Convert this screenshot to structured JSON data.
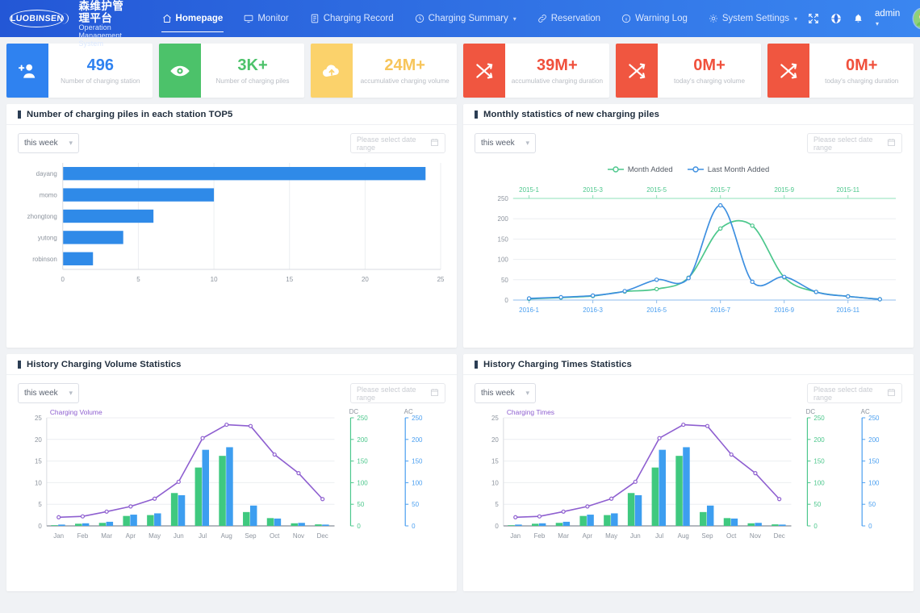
{
  "nav": {
    "logo_mark_text": "LUOBINSEN",
    "title_cn": "大连罗宾森维护管理平台",
    "title_en": "Operation Management System",
    "items": [
      {
        "label": "Homepage",
        "icon": "home-icon",
        "active": true,
        "has_caret": false
      },
      {
        "label": "Monitor",
        "icon": "monitor-icon",
        "active": false,
        "has_caret": false
      },
      {
        "label": "Charging Record",
        "icon": "document-icon",
        "active": false,
        "has_caret": false
      },
      {
        "label": "Charging Summary",
        "icon": "clock-icon",
        "active": false,
        "has_caret": true
      },
      {
        "label": "Reservation",
        "icon": "link-icon",
        "active": false,
        "has_caret": false
      },
      {
        "label": "Warning Log",
        "icon": "info-icon",
        "active": false,
        "has_caret": false
      },
      {
        "label": "System Settings",
        "icon": "gear-icon",
        "active": false,
        "has_caret": true
      }
    ],
    "right": {
      "fullscreen_icon": "fullscreen-icon",
      "language_icon": "globe-icon",
      "notification_icon": "bell-icon",
      "user_label": "admin",
      "avatar_icon": "user-avatar"
    }
  },
  "kpis": [
    {
      "value": "496",
      "label": "Number of charging station",
      "color": "#2f82f0",
      "bg": "#2f82f0",
      "icon": "add-user-icon"
    },
    {
      "value": "3K+",
      "label": "Number of charging piles",
      "color": "#4cc26a",
      "bg": "#4cc26a",
      "icon": "eye-icon"
    },
    {
      "value": "24M+",
      "label": "accumulative charging volume",
      "color": "#f7c55a",
      "bg": "#fbd26b",
      "icon": "cloud-upload-icon"
    },
    {
      "value": "39M+",
      "label": "accumulative charging duration",
      "color": "#f0503c",
      "bg": "#f05640",
      "icon": "shuffle-icon"
    },
    {
      "value": "0M+",
      "label": "today's charging volume",
      "color": "#f0503c",
      "bg": "#f05640",
      "icon": "shuffle-icon"
    },
    {
      "value": "0M+",
      "label": "today's charging duration",
      "color": "#f0503c",
      "bg": "#f05640",
      "icon": "shuffle-icon"
    }
  ],
  "controls": {
    "select_value": "this week",
    "daterange_placeholder": "Please select date range",
    "calendar_icon": "calendar-icon",
    "chevron_icon": "chevron-down-icon"
  },
  "panels": {
    "top_left": {
      "title": "Number of charging piles in each station TOP5"
    },
    "top_right": {
      "title": "Monthly statistics of new charging piles"
    },
    "bottom_left": {
      "title": "History Charging Volume Statistics"
    },
    "bottom_right": {
      "title": "History Charging Times Statistics"
    }
  },
  "chart_data": [
    {
      "id": "station-top5",
      "type": "bar",
      "orientation": "horizontal",
      "title": "Number of charging piles in each station TOP5",
      "categories": [
        "dayang",
        "momo",
        "zhongtong",
        "yutong",
        "robinson"
      ],
      "values": [
        24,
        10,
        6,
        4,
        2
      ],
      "xlabel": "",
      "ylabel": "",
      "xlim": [
        0,
        25
      ],
      "xticks": [
        0,
        5,
        10,
        15,
        20,
        25
      ],
      "bar_color": "#2f8ae8",
      "grid": true,
      "legend": "none"
    },
    {
      "id": "monthly-new-piles",
      "type": "line",
      "title": "Monthly statistics of new charging piles",
      "legend": [
        "Month Added",
        "Last Month Added"
      ],
      "legend_position": "top-center",
      "x_top_ticks": [
        "2015-1",
        "2015-3",
        "2015-5",
        "2015-7",
        "2015-9",
        "2015-11"
      ],
      "x_bottom_ticks": [
        "2016-1",
        "2016-3",
        "2016-5",
        "2016-7",
        "2016-9",
        "2016-11"
      ],
      "ylim": [
        0,
        250
      ],
      "yticks": [
        0,
        50,
        100,
        150,
        200,
        250
      ],
      "series": [
        {
          "name": "Month Added",
          "color": "#4cc78c",
          "axis": "top",
          "x": [
            "2015-1",
            "2015-2",
            "2015-3",
            "2015-4",
            "2015-5",
            "2015-6",
            "2015-7",
            "2015-8",
            "2015-9",
            "2015-10",
            "2015-11",
            "2015-12"
          ],
          "values": [
            3,
            6,
            10,
            21,
            27,
            55,
            176,
            183,
            56,
            20,
            9,
            2
          ]
        },
        {
          "name": "Last Month Added",
          "color": "#3d8fe0",
          "axis": "bottom",
          "x": [
            "2016-1",
            "2016-2",
            "2016-3",
            "2016-4",
            "2016-5",
            "2016-6",
            "2016-7",
            "2016-8",
            "2016-9",
            "2016-10",
            "2016-11",
            "2016-12"
          ],
          "values": [
            4,
            7,
            11,
            22,
            50,
            54,
            233,
            45,
            57,
            20,
            9,
            2
          ]
        }
      ],
      "grid": true
    },
    {
      "id": "history-charging-volume",
      "type": "bar",
      "title": "History Charging Volume Statistics",
      "left_axis_label": "Charging Volume",
      "left_axis_color": "#8e5fd0",
      "categories": [
        "Jan",
        "Feb",
        "Mar",
        "Apr",
        "May",
        "Jun",
        "Jul",
        "Aug",
        "Sep",
        "Oct",
        "Nov",
        "Dec"
      ],
      "left_ylim": [
        0,
        25
      ],
      "left_yticks": [
        0,
        5,
        10,
        15,
        20,
        25
      ],
      "right_axes": [
        {
          "name": "DC",
          "color": "#4cc78c",
          "ylim": [
            0,
            250
          ],
          "yticks": [
            0,
            50,
            100,
            150,
            200,
            250
          ]
        },
        {
          "name": "AC",
          "color": "#4a9ff0",
          "ylim": [
            0,
            250
          ],
          "yticks": [
            0,
            50,
            100,
            150,
            200,
            250
          ]
        }
      ],
      "series": [
        {
          "name": "DC",
          "type": "bar",
          "color": "#3fc97f",
          "values": [
            0.15,
            0.5,
            0.7,
            2.3,
            2.5,
            7.6,
            13.5,
            16.2,
            3.2,
            1.8,
            0.6,
            0.35
          ]
        },
        {
          "name": "AC",
          "type": "bar",
          "color": "#3d9ef0",
          "values": [
            0.3,
            0.6,
            0.95,
            2.6,
            2.9,
            7.1,
            17.6,
            18.2,
            4.7,
            1.7,
            0.7,
            0.3
          ]
        },
        {
          "name": "Charging Volume",
          "type": "line",
          "color": "#8e5fd0",
          "values": [
            2.0,
            2.2,
            3.3,
            4.5,
            6.3,
            10.2,
            20.3,
            23.4,
            23.1,
            16.5,
            12.2,
            6.2
          ]
        }
      ],
      "grid": true
    },
    {
      "id": "history-charging-times",
      "type": "bar",
      "title": "History Charging Times Statistics",
      "left_axis_label": "Charging Times",
      "left_axis_color": "#8e5fd0",
      "categories": [
        "Jan",
        "Feb",
        "Mar",
        "Apr",
        "May",
        "Jun",
        "Jul",
        "Aug",
        "Sep",
        "Oct",
        "Nov",
        "Dec"
      ],
      "left_ylim": [
        0,
        25
      ],
      "left_yticks": [
        0,
        5,
        10,
        15,
        20,
        25
      ],
      "right_axes": [
        {
          "name": "DC",
          "color": "#4cc78c",
          "ylim": [
            0,
            250
          ],
          "yticks": [
            0,
            50,
            100,
            150,
            200,
            250
          ]
        },
        {
          "name": "AC",
          "color": "#4a9ff0",
          "ylim": [
            0,
            250
          ],
          "yticks": [
            0,
            50,
            100,
            150,
            200,
            250
          ]
        }
      ],
      "series": [
        {
          "name": "DC",
          "type": "bar",
          "color": "#3fc97f",
          "values": [
            0.15,
            0.5,
            0.7,
            2.3,
            2.5,
            7.6,
            13.5,
            16.2,
            3.2,
            1.8,
            0.6,
            0.35
          ]
        },
        {
          "name": "AC",
          "type": "bar",
          "color": "#3d9ef0",
          "values": [
            0.3,
            0.6,
            0.95,
            2.6,
            2.9,
            7.1,
            17.6,
            18.2,
            4.7,
            1.7,
            0.7,
            0.3
          ]
        },
        {
          "name": "Charging Times",
          "type": "line",
          "color": "#8e5fd0",
          "values": [
            2.0,
            2.2,
            3.3,
            4.5,
            6.3,
            10.2,
            20.3,
            23.4,
            23.1,
            16.5,
            12.2,
            6.2
          ]
        }
      ],
      "grid": true
    }
  ]
}
